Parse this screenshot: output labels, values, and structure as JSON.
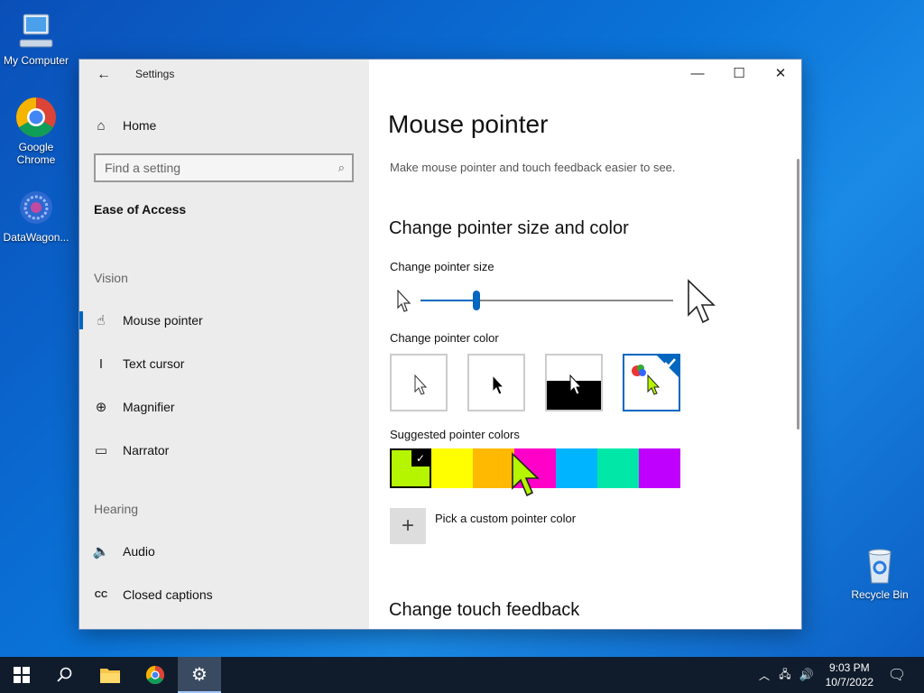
{
  "desktop": {
    "icons": [
      {
        "label": "My Computer",
        "icon": "computer-icon"
      },
      {
        "label": "Google Chrome",
        "icon": "chrome-icon"
      },
      {
        "label": "DataWagon...",
        "icon": "datawagon-icon"
      },
      {
        "label": "Recycle Bin",
        "icon": "recycle-bin-icon"
      }
    ]
  },
  "window": {
    "app_title": "Settings",
    "controls": {
      "minimize": "—",
      "maximize": "☐",
      "close": "✕"
    }
  },
  "nav": {
    "home": "Home",
    "search_placeholder": "Find a setting",
    "section": "Ease of Access",
    "vision_label": "Vision",
    "vision_items": [
      {
        "label": "Mouse pointer",
        "icon": "mouse-pointer-icon"
      },
      {
        "label": "Text cursor",
        "icon": "text-cursor-icon"
      },
      {
        "label": "Magnifier",
        "icon": "magnifier-icon"
      },
      {
        "label": "Narrator",
        "icon": "narrator-icon"
      }
    ],
    "hearing_label": "Hearing",
    "hearing_items": [
      {
        "label": "Audio",
        "icon": "audio-icon"
      },
      {
        "label": "Closed captions",
        "icon": "closed-captions-icon"
      }
    ]
  },
  "main": {
    "title": "Mouse pointer",
    "subtitle": "Make mouse pointer and touch feedback easier to see.",
    "section1": "Change pointer size and color",
    "size_label": "Change pointer size",
    "size_value": 0.22,
    "color_label": "Change pointer color",
    "color_options": [
      "white",
      "black",
      "inverted",
      "custom"
    ],
    "selected_color_option": "custom",
    "suggested_label": "Suggested pointer colors",
    "suggested_colors": [
      "#b5f500",
      "#ffff00",
      "#ffb900",
      "#ff00c8",
      "#00b4ff",
      "#00e7a8",
      "#c000ff"
    ],
    "selected_suggested": "#b5f500",
    "custom_label": "Pick a custom pointer color",
    "section2": "Change touch feedback"
  },
  "taskbar": {
    "time": "9:03 PM",
    "date": "10/7/2022",
    "items": [
      "start-icon",
      "search-icon",
      "file-explorer-icon",
      "chrome-icon",
      "settings-icon"
    ]
  }
}
